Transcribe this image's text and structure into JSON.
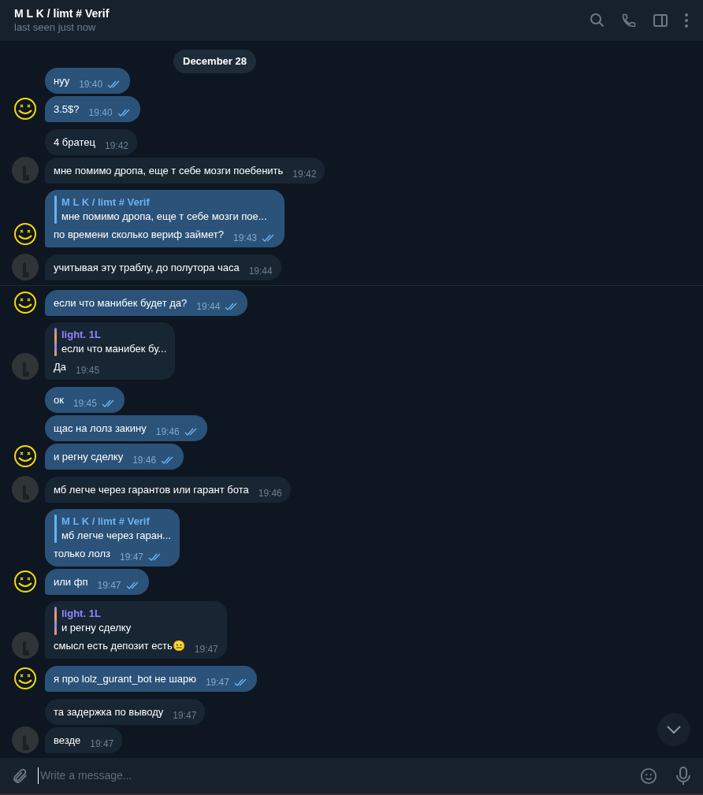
{
  "header": {
    "title": "M L K / limt # Verif",
    "status": "last seen just now"
  },
  "date_pill": "December 28",
  "messages": [
    {
      "kind": "out",
      "text": "нуу",
      "time": "19:40",
      "read": true,
      "avatar": false
    },
    {
      "kind": "out",
      "text": "3.5$?",
      "time": "19:40",
      "read": true,
      "avatar": true
    },
    {
      "kind": "in",
      "text": "4 братец",
      "time": "19:42",
      "avatar": false
    },
    {
      "kind": "in",
      "text": "мне помимо дропа, еще т себе мозги поебенить",
      "time": "19:42",
      "avatar": true
    },
    {
      "kind": "out",
      "text": "по времени сколько вериф займет?",
      "time": "19:43",
      "read": true,
      "avatar": true,
      "reply": {
        "name": "M L K / limt # Verif",
        "text": "мне помимо дропа, еще т себе мозги пое...",
        "color": "#6ab3f3"
      }
    },
    {
      "kind": "in",
      "text": "учитывая эту траблу, до полутора часа",
      "time": "19:44",
      "avatar": true,
      "divider_after": true
    },
    {
      "kind": "out",
      "text": "если что манибек будет да?",
      "time": "19:44",
      "read": true,
      "avatar": true
    },
    {
      "kind": "in",
      "text": "Да",
      "time": "19:45",
      "avatar": true,
      "reply": {
        "name": "light. 1L",
        "text": "если что манибек бу...",
        "color": "#8e86ff"
      }
    },
    {
      "kind": "out",
      "text": "ок",
      "time": "19:45",
      "read": true,
      "avatar": false
    },
    {
      "kind": "out",
      "text": "щас на лолз закину",
      "time": "19:46",
      "read": true,
      "avatar": false
    },
    {
      "kind": "out",
      "text": "и регну сделку",
      "time": "19:46",
      "read": true,
      "avatar": true
    },
    {
      "kind": "in",
      "text": "мб легче через гарантов или гарант бота",
      "time": "19:46",
      "avatar": true
    },
    {
      "kind": "out",
      "text": "только лолз",
      "time": "19:47",
      "read": true,
      "avatar": false,
      "reply": {
        "name": "M L K / limt # Verif",
        "text": "мб легче через гаран...",
        "color": "#6ab3f3"
      }
    },
    {
      "kind": "out",
      "text": "или фп",
      "time": "19:47",
      "read": true,
      "avatar": true
    },
    {
      "kind": "in",
      "text": "смысл есть депозит есть😐",
      "time": "19:47",
      "avatar": true,
      "reply": {
        "name": "light. 1L",
        "text": "и регну сделку",
        "color": "#8e86ff"
      }
    },
    {
      "kind": "out",
      "text": "я про lolz_gurant_bot не шарю",
      "time": "19:47",
      "read": true,
      "avatar": true
    },
    {
      "kind": "in",
      "text": "та задержка по выводу",
      "time": "19:47",
      "avatar": false
    },
    {
      "kind": "in",
      "text": "везде",
      "time": "19:47",
      "avatar": true
    }
  ],
  "composer": {
    "placeholder": "Write a message..."
  }
}
